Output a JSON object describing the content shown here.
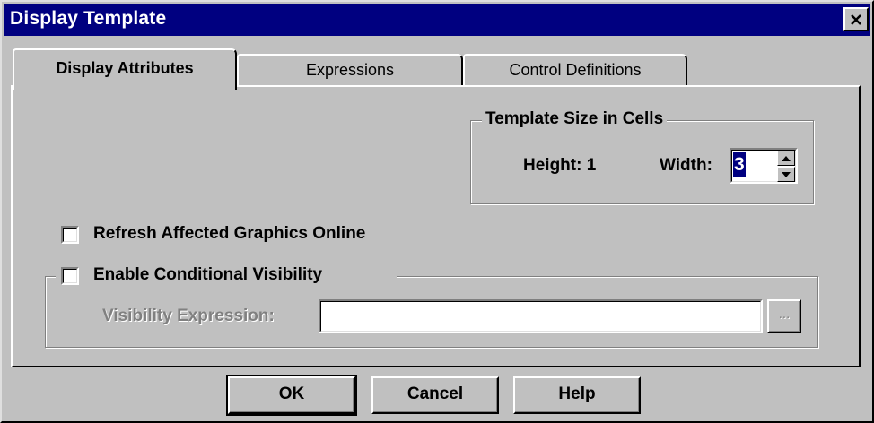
{
  "window": {
    "title": "Display Template",
    "close_icon": "close-icon"
  },
  "tabs": [
    {
      "label": "Display Attributes",
      "selected": true
    },
    {
      "label": "Expressions",
      "selected": false
    },
    {
      "label": "Control Definitions",
      "selected": false
    }
  ],
  "template_size": {
    "group_label": "Template Size in Cells",
    "height_label": "Height: 1",
    "width_label": "Width:",
    "width_value": "3"
  },
  "refresh": {
    "label": "Refresh Affected Graphics Online",
    "checked": false
  },
  "conditional_visibility": {
    "label": "Enable Conditional Visibility",
    "checked": false,
    "expression_label": "Visibility Expression:",
    "expression_value": "",
    "browse_label": "..."
  },
  "buttons": {
    "ok": "OK",
    "cancel": "Cancel",
    "help": "Help"
  },
  "colors": {
    "titlebar": "#000080",
    "face": "#c0c0c0",
    "disabled_text": "#808080"
  }
}
